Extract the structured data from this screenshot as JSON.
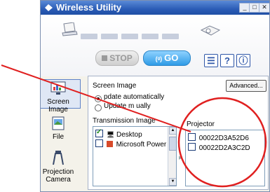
{
  "window": {
    "title": "Wireless Utility",
    "controls": {
      "minimize": "_",
      "maximize": "□",
      "close": "✕"
    }
  },
  "toolbar": {
    "stop_label": "STOP",
    "go_label": "GO",
    "menu_label": "☰",
    "help_label": "?",
    "info_label": "ⓘ"
  },
  "nav": {
    "items": [
      {
        "label": "Screen Image",
        "icon": "screen-image-icon",
        "selected": true
      },
      {
        "label": "File",
        "icon": "file-icon",
        "selected": false
      },
      {
        "label": "Projection Camera",
        "label_lines": [
          "Projection",
          "Camera"
        ],
        "icon": "camera-icon",
        "selected": false
      }
    ]
  },
  "screen_image": {
    "heading": "Screen Image",
    "advanced_label": "Advanced...",
    "update_auto": "Update automatically",
    "update_manual": "Update manually",
    "update_auto_visible": "pdate automatically",
    "update_manual_visible": "Update m     ually",
    "transmission_heading": "Transmission Image",
    "transmission_items": [
      {
        "label": "Desktop",
        "checked": true
      },
      {
        "label": "Microsoft Power",
        "checked": false
      }
    ],
    "projector_heading": "Projector",
    "projectors": [
      {
        "label": "00022D3A52D6",
        "checked": false
      },
      {
        "label": "00022D2A3C2D",
        "checked": false
      }
    ]
  },
  "colors": {
    "titlebar": "#2b5cb6",
    "callout": "#e02020",
    "go": "#2f9be6"
  }
}
